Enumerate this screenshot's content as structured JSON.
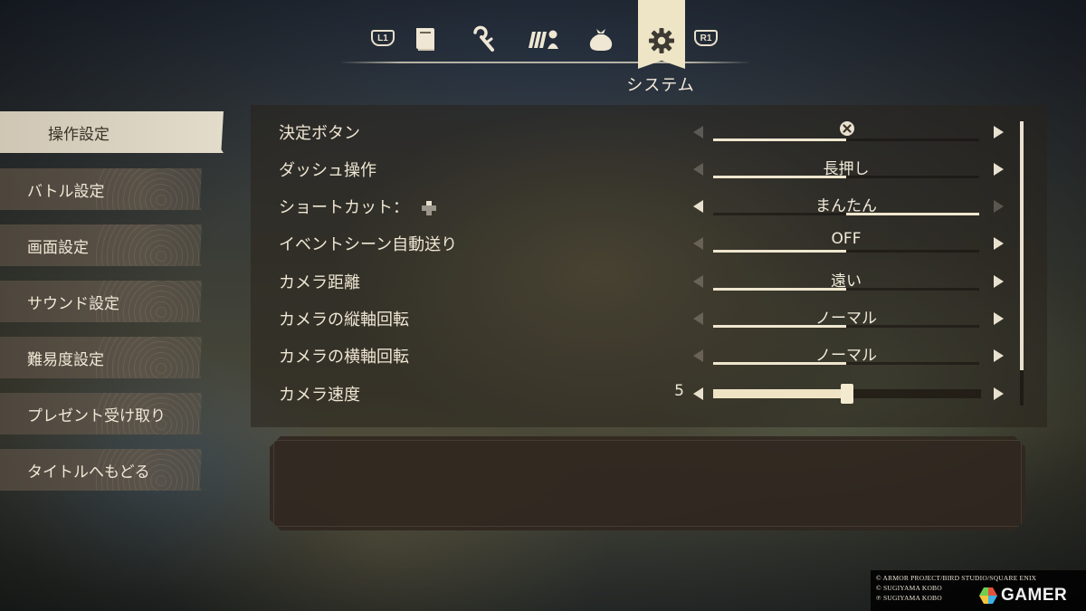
{
  "top_tabs": {
    "left_shoulder": "L1",
    "right_shoulder": "R1",
    "icons": [
      "book-icon",
      "magic-wand-icon",
      "party-icon",
      "bag-icon",
      "gear-icon"
    ],
    "active_icon": "gear-icon",
    "active_label": "システム"
  },
  "sidebar": {
    "items": [
      {
        "label": "操作設定",
        "active": true
      },
      {
        "label": "バトル設定",
        "active": false
      },
      {
        "label": "画面設定",
        "active": false
      },
      {
        "label": "サウンド設定",
        "active": false
      },
      {
        "label": "難易度設定",
        "active": false
      },
      {
        "label": "プレゼント受け取り",
        "active": false
      },
      {
        "label": "タイトルへもどる",
        "active": false
      }
    ]
  },
  "settings": [
    {
      "name": "決定ボタン",
      "value_icon": "cross-button-icon",
      "value": "",
      "option_index": 0,
      "option_count": 2
    },
    {
      "name": "ダッシュ操作",
      "value": "長押し",
      "option_index": 0,
      "option_count": 2
    },
    {
      "name": "ショートカット：",
      "name_icon": "dpad-icon",
      "value": "まんたん",
      "option_index": 1,
      "option_count": 2
    },
    {
      "name": "イベントシーン自動送り",
      "value": "OFF",
      "option_index": 0,
      "option_count": 2
    },
    {
      "name": "カメラ距離",
      "value": "遠い",
      "option_index": 0,
      "option_count": 2
    },
    {
      "name": "カメラの縦軸回転",
      "value": "ノーマル",
      "option_index": 0,
      "option_count": 2
    },
    {
      "name": "カメラの横軸回転",
      "value": "ノーマル",
      "option_index": 0,
      "option_count": 2
    },
    {
      "name": "カメラ速度",
      "value": "5",
      "slider_fraction": 0.5
    }
  ],
  "description": "",
  "copyright": [
    "© ARMOR PROJECT/BIRD STUDIO/SQUARE ENIX",
    "© SUGIYAMA KOBO",
    "℗ SUGIYAMA KOBO"
  ],
  "watermark": "GAMER",
  "colors": {
    "accent": "#eee5c6",
    "active_menu_bg": "#d8d0bf",
    "menu_bg": "#5a5145",
    "text": "#efe6d3"
  }
}
